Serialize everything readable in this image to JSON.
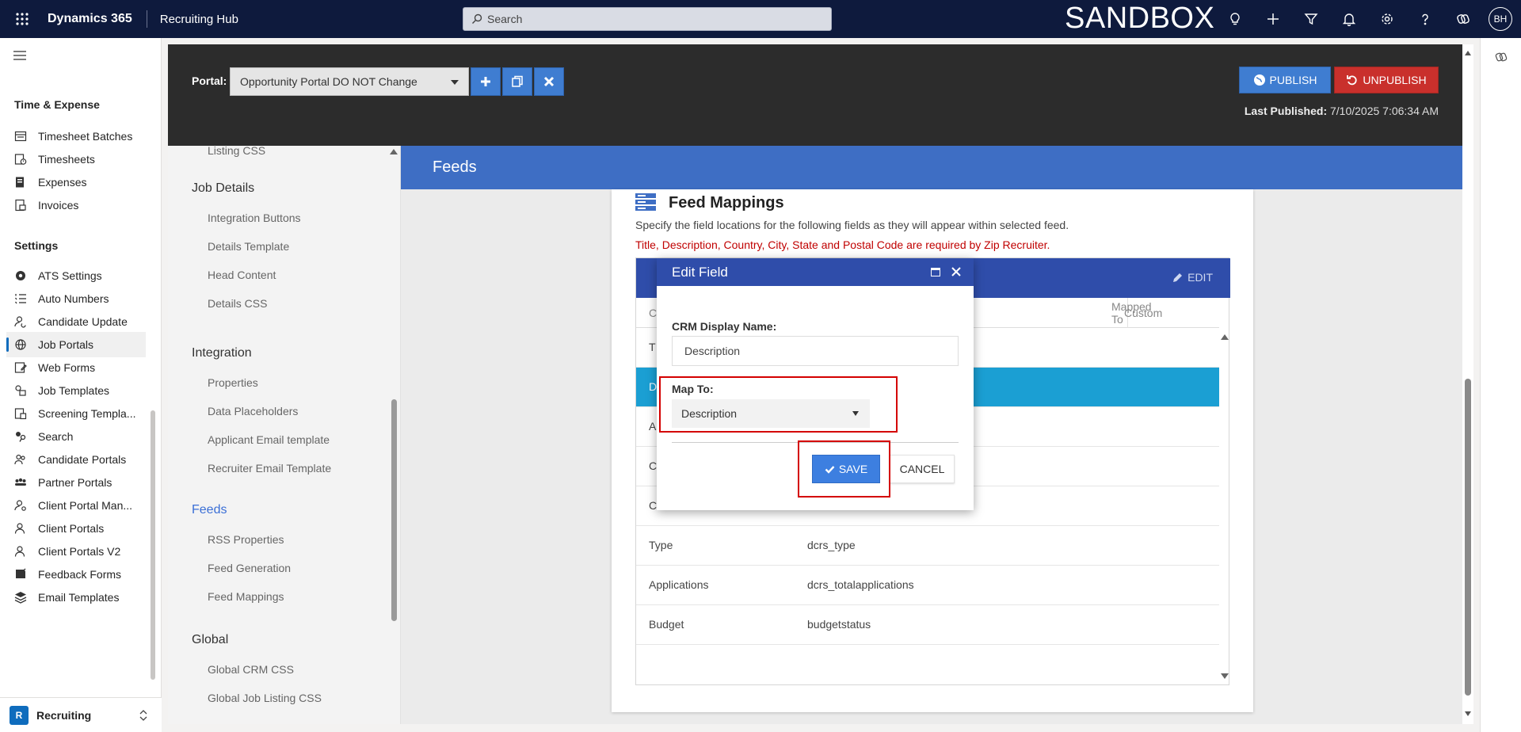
{
  "topbar": {
    "brand": "Dynamics 365",
    "app": "Recruiting Hub",
    "search_placeholder": "Search",
    "env_label": "SANDBOX",
    "user_initials": "BH",
    "icons": [
      "lightbulb-icon",
      "plus-icon",
      "filter-icon",
      "bell-icon",
      "gear-icon",
      "help-icon",
      "copilot-icon"
    ]
  },
  "nav": {
    "section_time": "Time & Expense",
    "time_items": [
      {
        "label": "Timesheet Batches",
        "icon": "timesheet-batches-icon"
      },
      {
        "label": "Timesheets",
        "icon": "timesheets-icon"
      },
      {
        "label": "Expenses",
        "icon": "expenses-icon"
      },
      {
        "label": "Invoices",
        "icon": "invoices-icon"
      }
    ],
    "section_settings": "Settings",
    "settings_items": [
      {
        "label": "ATS Settings",
        "icon": "gear-icon"
      },
      {
        "label": "Auto Numbers",
        "icon": "list-numbers-icon"
      },
      {
        "label": "Candidate Update",
        "icon": "person-sync-icon"
      },
      {
        "label": "Job Portals",
        "icon": "globe-icon",
        "active": true
      },
      {
        "label": "Web Forms",
        "icon": "form-icon"
      },
      {
        "label": "Job Templates",
        "icon": "template-icon"
      },
      {
        "label": "Screening Templa...",
        "icon": "screening-icon"
      },
      {
        "label": "Search",
        "icon": "search-people-icon"
      },
      {
        "label": "Candidate Portals",
        "icon": "people-icon"
      },
      {
        "label": "Partner Portals",
        "icon": "people-team-icon"
      },
      {
        "label": "Client Portal Man...",
        "icon": "person-settings-icon"
      },
      {
        "label": "Client Portals",
        "icon": "person-icon"
      },
      {
        "label": "Client Portals V2",
        "icon": "person-icon"
      },
      {
        "label": "Feedback Forms",
        "icon": "feedback-icon"
      },
      {
        "label": "Email Templates",
        "icon": "layers-icon"
      }
    ],
    "area": {
      "badge": "R",
      "name": "Recruiting"
    }
  },
  "portal": {
    "label": "Portal:",
    "selected": "Opportunity Portal DO NOT Change",
    "publish_label": "PUBLISH",
    "unpublish_label": "UNPUBLISH",
    "last_published_label": "Last Published:",
    "last_published_value": "7/10/2025 7:06:34 AM"
  },
  "inner_sidebar": {
    "top_item": "Listing CSS",
    "groups": [
      {
        "title": "Job Details",
        "items": [
          "Integration Buttons",
          "Details Template",
          "Head Content",
          "Details CSS"
        ]
      },
      {
        "title": "Integration",
        "items": [
          "Properties",
          "Data Placeholders",
          "Applicant Email template",
          "Recruiter Email Template"
        ]
      },
      {
        "title": "Feeds",
        "items": [
          "RSS Properties",
          "Feed Generation",
          "Feed Mappings"
        ]
      },
      {
        "title": "Global",
        "items": [
          "Global CRM CSS",
          "Global Job Listing CSS"
        ]
      }
    ]
  },
  "content": {
    "banner": "Feeds",
    "card_title": "Feed Mappings",
    "card_sub": "Specify the field locations for the following fields as they will appear within selected feed.",
    "card_warning": "Title, Description, Country, City, State and Postal Code are required by Zip Recruiter.",
    "edit_label": "EDIT",
    "columns": {
      "c1": "C",
      "c2": "Mapped To",
      "c3": "Custom"
    },
    "rows": [
      {
        "name": "T",
        "value": ""
      },
      {
        "name": "D",
        "value": "",
        "selected": true
      },
      {
        "name": "A",
        "value": ""
      },
      {
        "name": "C",
        "value": ""
      },
      {
        "name": "C",
        "value": ""
      },
      {
        "name": "Type",
        "value": "dcrs_type"
      },
      {
        "name": "Applications",
        "value": "dcrs_totalapplications"
      },
      {
        "name": "Budget",
        "value": "budgetstatus"
      }
    ]
  },
  "modal": {
    "title": "Edit Field",
    "crm_label": "CRM Display Name:",
    "crm_value": "Description",
    "map_label": "Map To:",
    "map_value": "Description",
    "save_label": "SAVE",
    "cancel_label": "CANCEL"
  },
  "colors": {
    "topbar": "#0e1a3d",
    "accent_blue": "#3e6ec4",
    "modal_header": "#2f4daa",
    "selected_row": "#1b9fd3",
    "unpublish": "#c9302c",
    "highlight": "#d40000"
  }
}
